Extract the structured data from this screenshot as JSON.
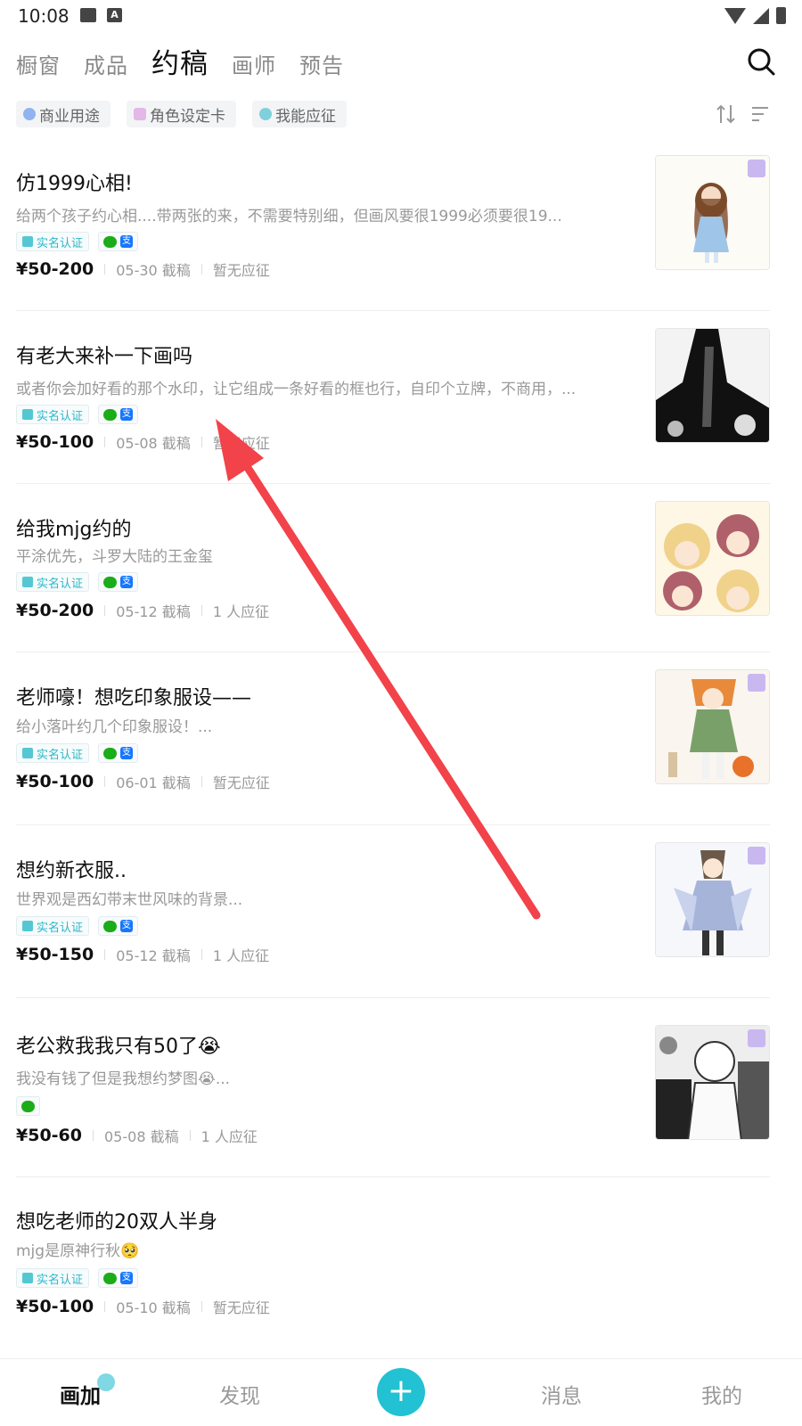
{
  "status_bar": {
    "time": "10:08"
  },
  "top_tabs": [
    {
      "label": "橱窗",
      "active": false
    },
    {
      "label": "成品",
      "active": false
    },
    {
      "label": "约稿",
      "active": true
    },
    {
      "label": "画师",
      "active": false
    },
    {
      "label": "预告",
      "active": false
    }
  ],
  "filters": [
    {
      "label": "商业用途",
      "color": "#8fb4f0"
    },
    {
      "label": "角色设定卡",
      "color": "#e3b7e8"
    },
    {
      "label": "我能应征",
      "color": "#7fd0dc"
    }
  ],
  "common": {
    "verify_label": "实名认证",
    "ali_label": "支"
  },
  "items": [
    {
      "title": "仿1999心相!",
      "desc": "给两个孩子约心相....带两张的来，不需要特别细，但画风要很1999必须要很19...",
      "verified": true,
      "ali": true,
      "price": "¥50-200",
      "deadline": "05-30 截稿",
      "applicants": "暂无应征",
      "thumb_colors": [
        "#fdfbf6",
        "#7a4a2a",
        "#9fc5e8"
      ],
      "tagged": true
    },
    {
      "title": "有老大来补一下画吗",
      "desc": "或者你会加好看的那个水印，让它组成一条好看的框也行，自印个立牌，不商用，...",
      "verified": true,
      "ali": true,
      "price": "¥50-100",
      "deadline": "05-08 截稿",
      "applicants": "暂无应征",
      "thumb_colors": [
        "#f3f3f3",
        "#111111",
        "#555555"
      ],
      "tagged": false
    },
    {
      "title": "给我mjg约的",
      "desc": "平涂优先，斗罗大陆的王金玺",
      "verified": true,
      "ali": true,
      "price": "¥50-200",
      "deadline": "05-12 截稿",
      "applicants": "1 人应征",
      "thumb_colors": [
        "#fff7e6",
        "#f0d28a",
        "#b0606a"
      ],
      "tagged": false
    },
    {
      "title": "老师嚎！想吃印象服设——",
      "desc": "给小落叶约几个印象服设！...",
      "verified": true,
      "ali": true,
      "price": "¥50-100",
      "deadline": "06-01 截稿",
      "applicants": "暂无应征",
      "thumb_colors": [
        "#faf5ee",
        "#e88a3a",
        "#7aa06a"
      ],
      "tagged": true
    },
    {
      "title": "想约新衣服..",
      "desc": "世界观是西幻带末世风味的背景...",
      "verified": true,
      "ali": true,
      "price": "¥50-150",
      "deadline": "05-12 截稿",
      "applicants": "1 人应征",
      "thumb_colors": [
        "#f6f7fb",
        "#a7b4da",
        "#6b5a4a"
      ],
      "tagged": true
    },
    {
      "title": "老公救我我只有50了😭",
      "desc": "我没有钱了但是我想约梦图😭...",
      "verified": false,
      "ali": false,
      "price": "¥50-60",
      "deadline": "05-08 截稿",
      "applicants": "1 人应征",
      "thumb_colors": [
        "#eeeeee",
        "#222222",
        "#888888"
      ],
      "tagged": true
    },
    {
      "title": "想吃老师的20双人半身",
      "desc": "mjg是原神行秋🥺",
      "verified": true,
      "ali": true,
      "price": "¥50-100",
      "deadline": "05-10 截稿",
      "applicants": "暂无应征",
      "thumb_colors": null,
      "tagged": false
    }
  ],
  "bottom_nav": [
    {
      "label": "画加",
      "active": true
    },
    {
      "label": "发现",
      "active": false
    },
    {
      "label": "+",
      "active": false
    },
    {
      "label": "消息",
      "active": false
    },
    {
      "label": "我的",
      "active": false
    }
  ],
  "colors": {
    "accent": "#22c1d3",
    "arrow": "#f2424a"
  }
}
